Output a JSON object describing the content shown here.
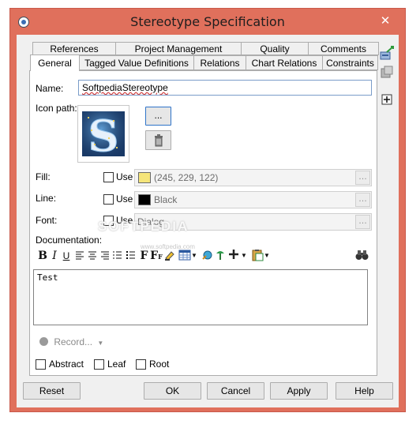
{
  "window": {
    "title": "Stereotype Specification",
    "close_symbol": "✕"
  },
  "tabs_back": [
    "References",
    "Project Management",
    "Quality",
    "Comments"
  ],
  "tabs_front": [
    "General",
    "Tagged Value Definitions",
    "Relations",
    "Chart Relations",
    "Constraints"
  ],
  "general": {
    "name_label": "Name:",
    "name_value": "SoftpediaStereotype",
    "icon_path_label": "Icon path:",
    "browse_label": "...",
    "fill_label": "Fill:",
    "line_label": "Line:",
    "font_label": "Font:",
    "use_label": "Use",
    "fill_value": "(245, 229, 122)",
    "line_value": "Black",
    "font_value": "Dialog",
    "fill_color": "#f5e57a",
    "line_color": "#000000",
    "documentation_label": "Documentation:",
    "documentation_text": "Test",
    "record_label": "Record...",
    "abstract_label": "Abstract",
    "leaf_label": "Leaf",
    "root_label": "Root"
  },
  "toolbar": {
    "bold": "B",
    "italic": "I",
    "underline": "U",
    "font": "F",
    "font_size": "F"
  },
  "watermark": {
    "text": "SOFTPEDIA",
    "sub": "www.softpedia.com"
  },
  "buttons": {
    "reset": "Reset",
    "ok": "OK",
    "cancel": "Cancel",
    "apply": "Apply",
    "help": "Help"
  },
  "colors": {
    "titlebar": "#e0705c",
    "dialog_bg": "#f0f0f0",
    "focus_blue": "#2f74c9"
  }
}
